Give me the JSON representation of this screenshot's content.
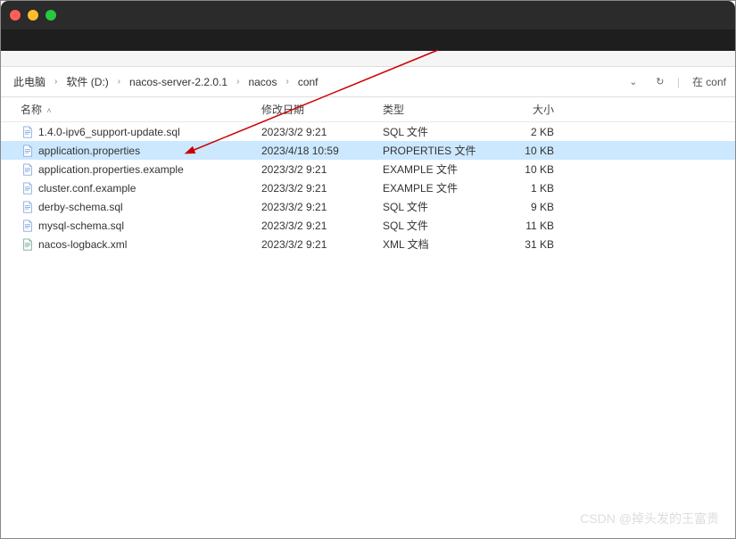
{
  "breadcrumb": {
    "items": [
      "此电脑",
      "软件 (D:)",
      "nacos-server-2.2.0.1",
      "nacos",
      "conf"
    ]
  },
  "search": {
    "hint": "在 conf"
  },
  "columns": {
    "name": "名称",
    "date": "修改日期",
    "type": "类型",
    "size": "大小"
  },
  "files": [
    {
      "name": "1.4.0-ipv6_support-update.sql",
      "date": "2023/3/2 9:21",
      "type": "SQL 文件",
      "size": "2 KB",
      "selected": false
    },
    {
      "name": "application.properties",
      "date": "2023/4/18 10:59",
      "type": "PROPERTIES 文件",
      "size": "10 KB",
      "selected": true
    },
    {
      "name": "application.properties.example",
      "date": "2023/3/2 9:21",
      "type": "EXAMPLE 文件",
      "size": "10 KB",
      "selected": false
    },
    {
      "name": "cluster.conf.example",
      "date": "2023/3/2 9:21",
      "type": "EXAMPLE 文件",
      "size": "1 KB",
      "selected": false
    },
    {
      "name": "derby-schema.sql",
      "date": "2023/3/2 9:21",
      "type": "SQL 文件",
      "size": "9 KB",
      "selected": false
    },
    {
      "name": "mysql-schema.sql",
      "date": "2023/3/2 9:21",
      "type": "SQL 文件",
      "size": "11 KB",
      "selected": false
    },
    {
      "name": "nacos-logback.xml",
      "date": "2023/3/2 9:21",
      "type": "XML 文档",
      "size": "31 KB",
      "selected": false
    }
  ],
  "watermark": "CSDN @掉头发的王富贵"
}
